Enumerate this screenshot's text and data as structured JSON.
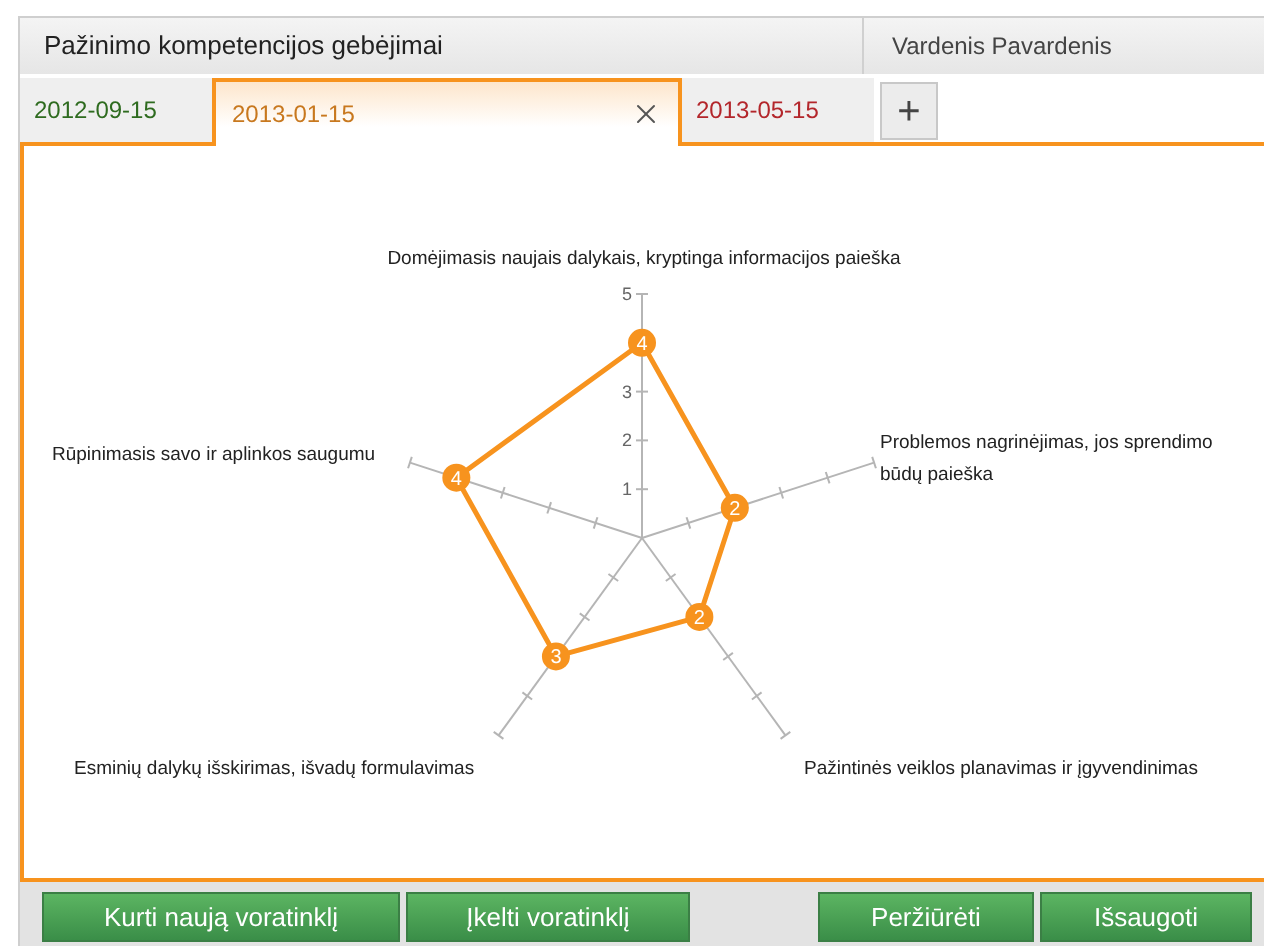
{
  "header": {
    "title": "Pažinimo kompetencijos gebėjimai",
    "user": "Vardenis Pavardenis"
  },
  "tabs": [
    {
      "label": "2012-09-15",
      "selected": false,
      "color": "#2e6b1f"
    },
    {
      "label": "2013-01-15",
      "selected": true,
      "color": "#c8781e"
    },
    {
      "label": "2013-05-15",
      "selected": false,
      "color": "#b3262b"
    }
  ],
  "add_tab": "+",
  "radar_chart": {
    "scale_labels": [
      "5",
      "3",
      "2",
      "1"
    ],
    "axes": [
      {
        "label": "Domėjimasis naujais dalykais, kryptinga informacijos paieška",
        "value": "4"
      },
      {
        "label": "Rūpinimasis savo ir aplinkos saugumu",
        "value": "4"
      },
      {
        "label": "Problemos nagrinėjimas, jos sprendimo būdų paieška",
        "value": "2"
      },
      {
        "label": "Esminių dalykų išskirimas, išvadų formulavimas",
        "value": "3"
      },
      {
        "label": "Pažintinės veiklos planavimas ir įgyvendinimas",
        "value": "2"
      }
    ]
  },
  "buttons": [
    {
      "label": "Kurti naują voratinklį"
    },
    {
      "label": "Įkelti voratinklį"
    },
    {
      "label": "Peržiūrėti"
    },
    {
      "label": "Išsaugoti"
    }
  ]
}
